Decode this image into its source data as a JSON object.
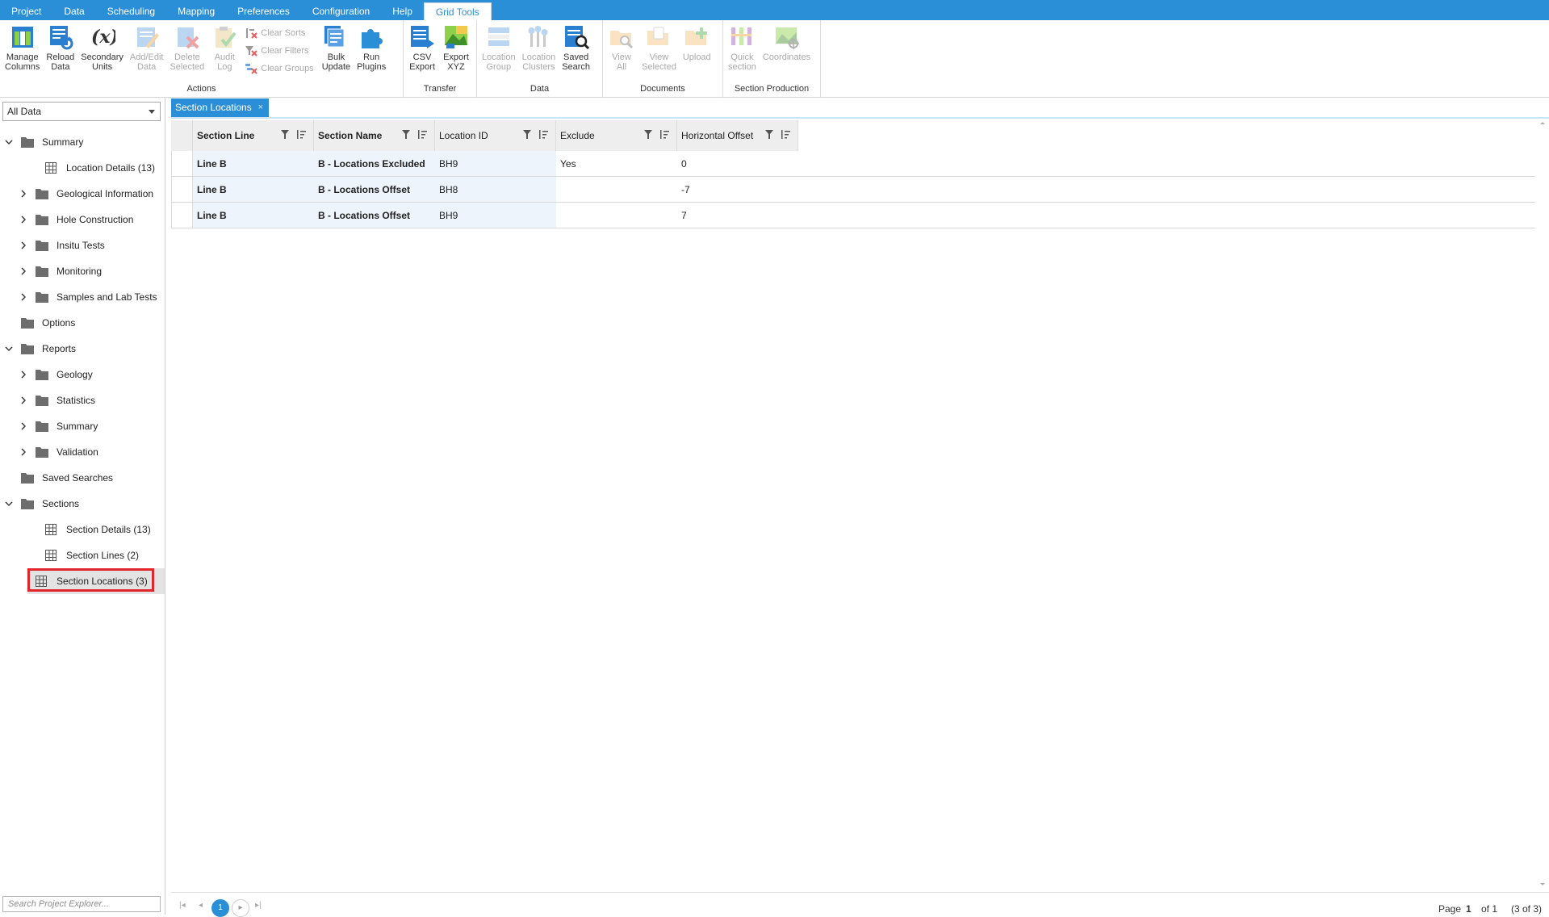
{
  "menubar": {
    "items": [
      "Project",
      "Data",
      "Scheduling",
      "Mapping",
      "Preferences",
      "Configuration",
      "Help",
      "Grid Tools"
    ],
    "active": "Grid Tools"
  },
  "ribbon": {
    "groups": {
      "actions": "Actions",
      "transfer": "Transfer",
      "data": "Data",
      "documents": "Documents",
      "section_production": "Section Production"
    },
    "buttons": {
      "manage_columns": "Manage\nColumns",
      "reload_data": "Reload\nData",
      "secondary_units": "Secondary\nUnits",
      "add_edit_data": "Add/Edit\nData",
      "delete_selected": "Delete\nSelected",
      "audit_log": "Audit\nLog",
      "clear_sorts": "Clear Sorts",
      "clear_filters": "Clear Filters",
      "clear_groups": "Clear Groups",
      "bulk_update": "Bulk\nUpdate",
      "run_plugins": "Run\nPlugins",
      "csv_export": "CSV\nExport",
      "export_xyz": "Export\nXYZ",
      "location_group": "Location\nGroup",
      "location_clusters": "Location\nClusters",
      "saved_search": "Saved\nSearch",
      "view_all": "View\nAll",
      "view_selected": "View\nSelected",
      "upload": "Upload",
      "quick_section": "Quick\nsection",
      "coordinates": "Coordinates"
    }
  },
  "explorer": {
    "filter_selected": "All Data",
    "search_placeholder": "Search Project Explorer...",
    "tree": [
      {
        "label": "Summary",
        "type": "folder",
        "level": 0,
        "expander": "expanded"
      },
      {
        "label": "Location Details (13)",
        "type": "grid",
        "level": 1,
        "expander": "none"
      },
      {
        "label": "Geological Information",
        "type": "folder",
        "level": 1,
        "expander": "collapsed"
      },
      {
        "label": "Hole Construction",
        "type": "folder",
        "level": 1,
        "expander": "collapsed"
      },
      {
        "label": "Insitu Tests",
        "type": "folder",
        "level": 1,
        "expander": "collapsed"
      },
      {
        "label": "Monitoring",
        "type": "folder",
        "level": 1,
        "expander": "collapsed"
      },
      {
        "label": "Samples and Lab Tests",
        "type": "folder",
        "level": 1,
        "expander": "collapsed"
      },
      {
        "label": "Options",
        "type": "folder",
        "level": 0,
        "expander": "none"
      },
      {
        "label": "Reports",
        "type": "folder",
        "level": 0,
        "expander": "expanded"
      },
      {
        "label": "Geology",
        "type": "folder",
        "level": 1,
        "expander": "collapsed"
      },
      {
        "label": "Statistics",
        "type": "folder",
        "level": 1,
        "expander": "collapsed"
      },
      {
        "label": "Summary",
        "type": "folder",
        "level": 1,
        "expander": "collapsed"
      },
      {
        "label": "Validation",
        "type": "folder",
        "level": 1,
        "expander": "collapsed"
      },
      {
        "label": "Saved Searches",
        "type": "folder",
        "level": 0,
        "expander": "none"
      },
      {
        "label": "Sections",
        "type": "folder",
        "level": 0,
        "expander": "expanded"
      },
      {
        "label": "Section Details (13)",
        "type": "grid",
        "level": 1,
        "expander": "none"
      },
      {
        "label": "Section Lines (2)",
        "type": "grid",
        "level": 1,
        "expander": "none"
      },
      {
        "label": "Section Locations (3)",
        "type": "grid",
        "level": 1,
        "expander": "none",
        "selected": true
      }
    ]
  },
  "document_tab": {
    "title": "Section Locations",
    "close": "×"
  },
  "grid": {
    "columns": [
      {
        "label": "Section Line",
        "key": true
      },
      {
        "label": "Section Name",
        "key": true
      },
      {
        "label": "Location ID",
        "key": false
      },
      {
        "label": "Exclude",
        "key": false
      },
      {
        "label": "Horizontal Offset",
        "key": false
      }
    ],
    "rows": [
      [
        "Line B",
        "B - Locations Excluded",
        "BH9",
        "Yes",
        "0"
      ],
      [
        "Line B",
        "B - Locations Offset",
        "BH8",
        "",
        "-7"
      ],
      [
        "Line B",
        "B - Locations Offset",
        "BH9",
        "",
        "7"
      ]
    ]
  },
  "pager": {
    "current_page": "1",
    "page_label": "Page",
    "page_value": "1",
    "of_label": "of 1",
    "count_label": "(3 of 3)"
  },
  "colors": {
    "accent": "#2b8fd8",
    "selection_outline": "#e0262b",
    "key_column_bg": "#edf4fb"
  }
}
